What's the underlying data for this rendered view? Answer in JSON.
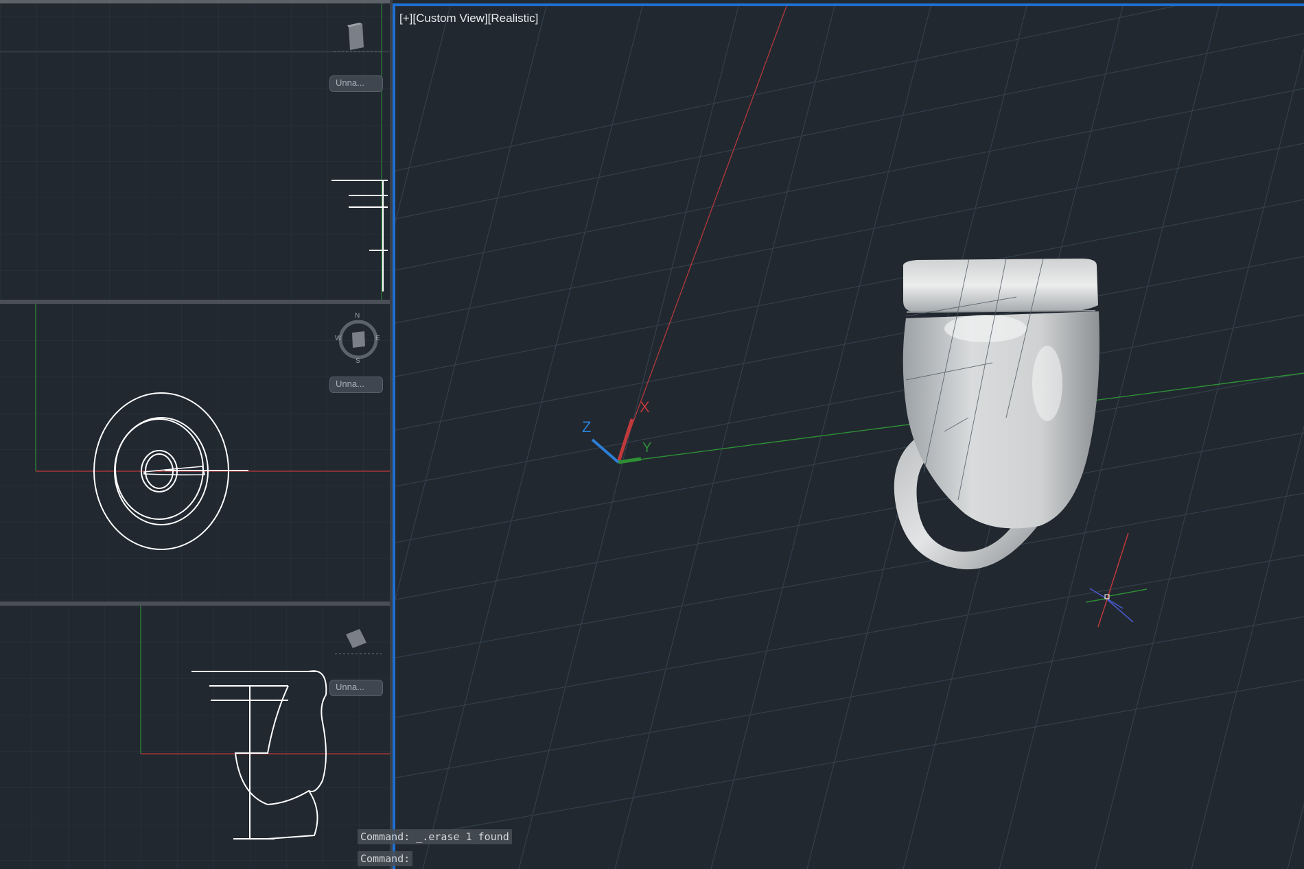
{
  "viewports": {
    "top": {
      "viewcube_label": "Unna..."
    },
    "middle": {
      "viewcube_label": "Unna...",
      "compass": {
        "north": "N",
        "south": "S",
        "east": "E",
        "west": "W"
      }
    },
    "bottom": {
      "viewcube_label": "Unna..."
    },
    "main": {
      "label": "[+][Custom View][Realistic]",
      "ucs": {
        "x_label": "X",
        "y_label": "Y",
        "z_label": "Z"
      }
    }
  },
  "command": {
    "history": "Command:  _.erase 1 found",
    "prompt": "Command:"
  },
  "colors": {
    "background": "#212830",
    "grid": "#34404c",
    "x_axis": "#c0393b",
    "y_axis": "#2e8f35",
    "z_axis": "#2d7fd6",
    "active_border": "#1f6fd1",
    "geometry": "#ffffff"
  },
  "icons": {
    "viewcube": "viewcube-icon",
    "crosshair": "crosshair-cursor-icon",
    "ucs": "ucs-axis-icon"
  }
}
